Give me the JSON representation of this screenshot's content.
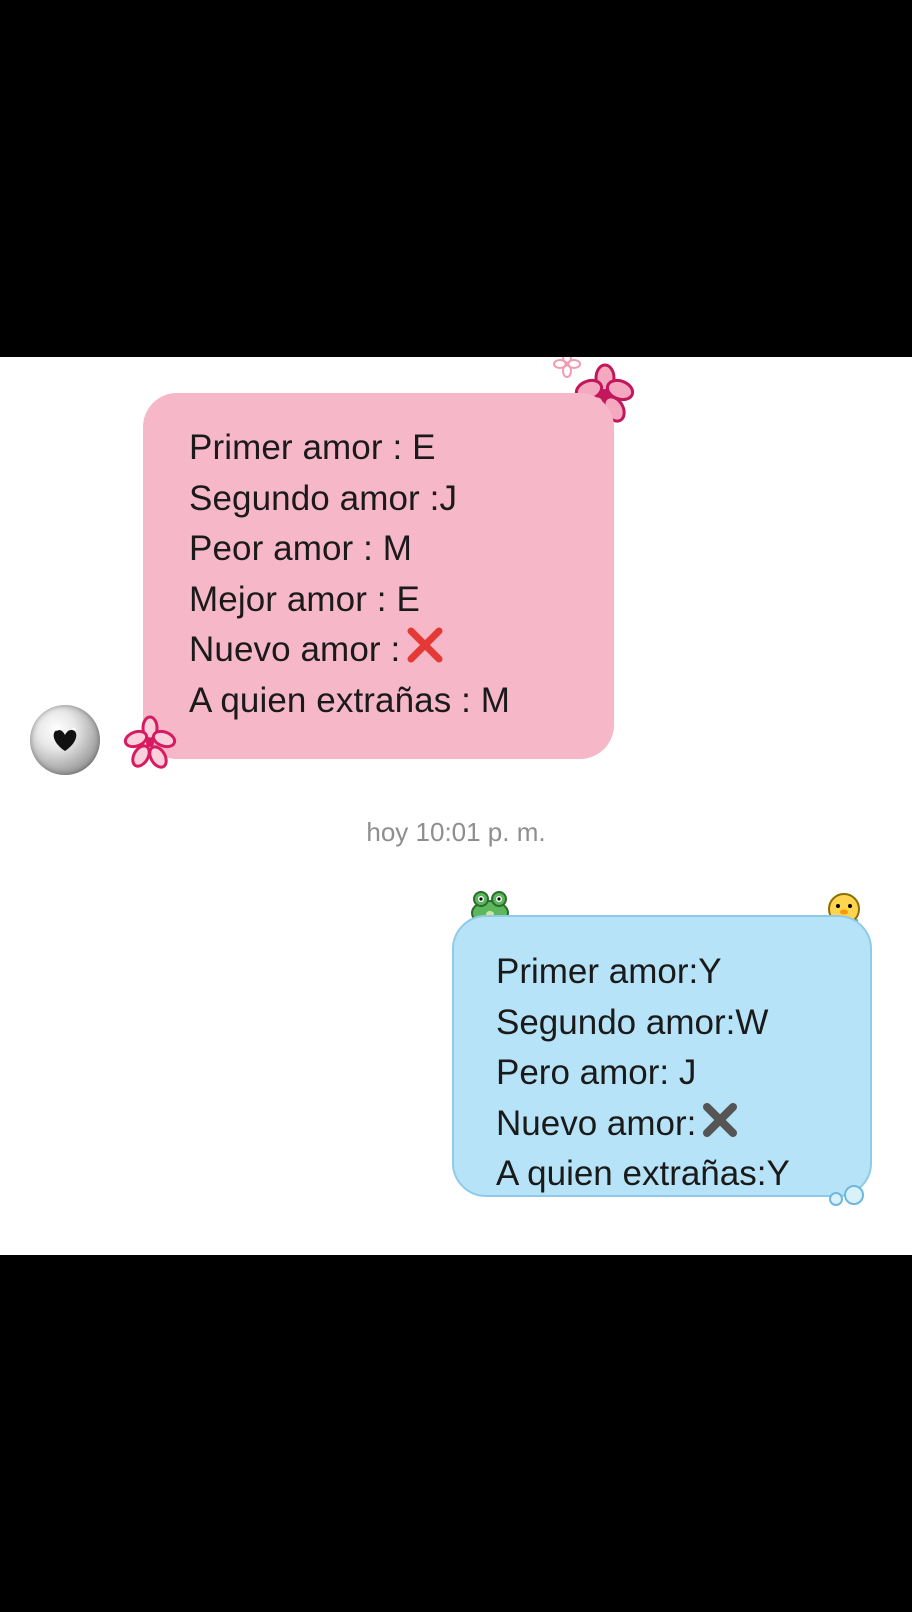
{
  "chat": {
    "received": {
      "lines": [
        "Primer amor : E",
        "Segundo amor :J",
        "Peor amor : M",
        "Mejor amor : E",
        "Nuevo amor :",
        "A quien extrañas : M"
      ],
      "inline_icon": "red-cross-mark-icon",
      "bubble_color": "#f6b7c9",
      "sticker_icons": [
        "pink-flower-icon",
        "small-pink-flower-icon"
      ]
    },
    "timestamp": "hoy 10:01 p. m.",
    "sent": {
      "lines": [
        "Primer amor:Y",
        "Segundo amor:W",
        "Pero amor: J",
        "Nuevo amor:",
        "A quien extrañas:Y"
      ],
      "inline_icon": "gray-multiply-icon",
      "bubble_color": "#b6e3f7",
      "sticker_icons": [
        "green-frog-icon",
        "yellow-duck-icon",
        "bubbles-icon"
      ]
    },
    "avatar_icon": "black-heart-avatar-icon"
  }
}
